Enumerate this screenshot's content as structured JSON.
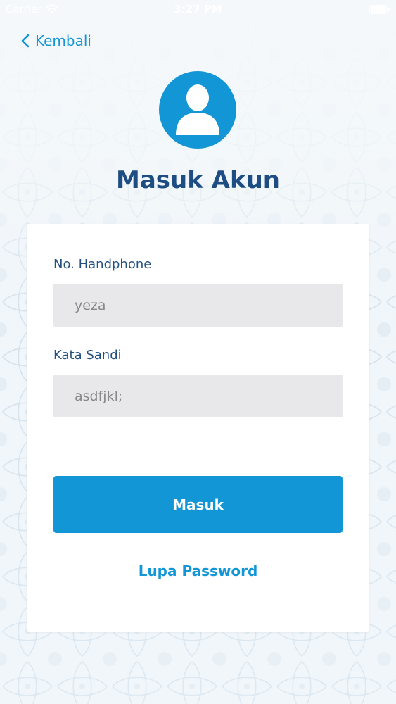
{
  "status_bar": {
    "carrier": "Carrier",
    "time": "3:27 PM",
    "wifi_icon": "wifi-icon",
    "battery_icon": "battery-icon"
  },
  "nav": {
    "back_label": "Kembali",
    "back_icon": "chevron-left-icon"
  },
  "header": {
    "avatar_icon": "user-icon",
    "title": "Masuk Akun"
  },
  "form": {
    "phone_label": "No. Handphone",
    "phone_value": "yeza",
    "password_label": "Kata Sandi",
    "password_value": "asdfjkl;",
    "submit_label": "Masuk",
    "forgot_label": "Lupa Password"
  },
  "colors": {
    "accent": "#1396d6",
    "title": "#1d4d82",
    "label": "#24507f",
    "input_bg": "#e8e7e9",
    "background": "#eef4f9"
  }
}
